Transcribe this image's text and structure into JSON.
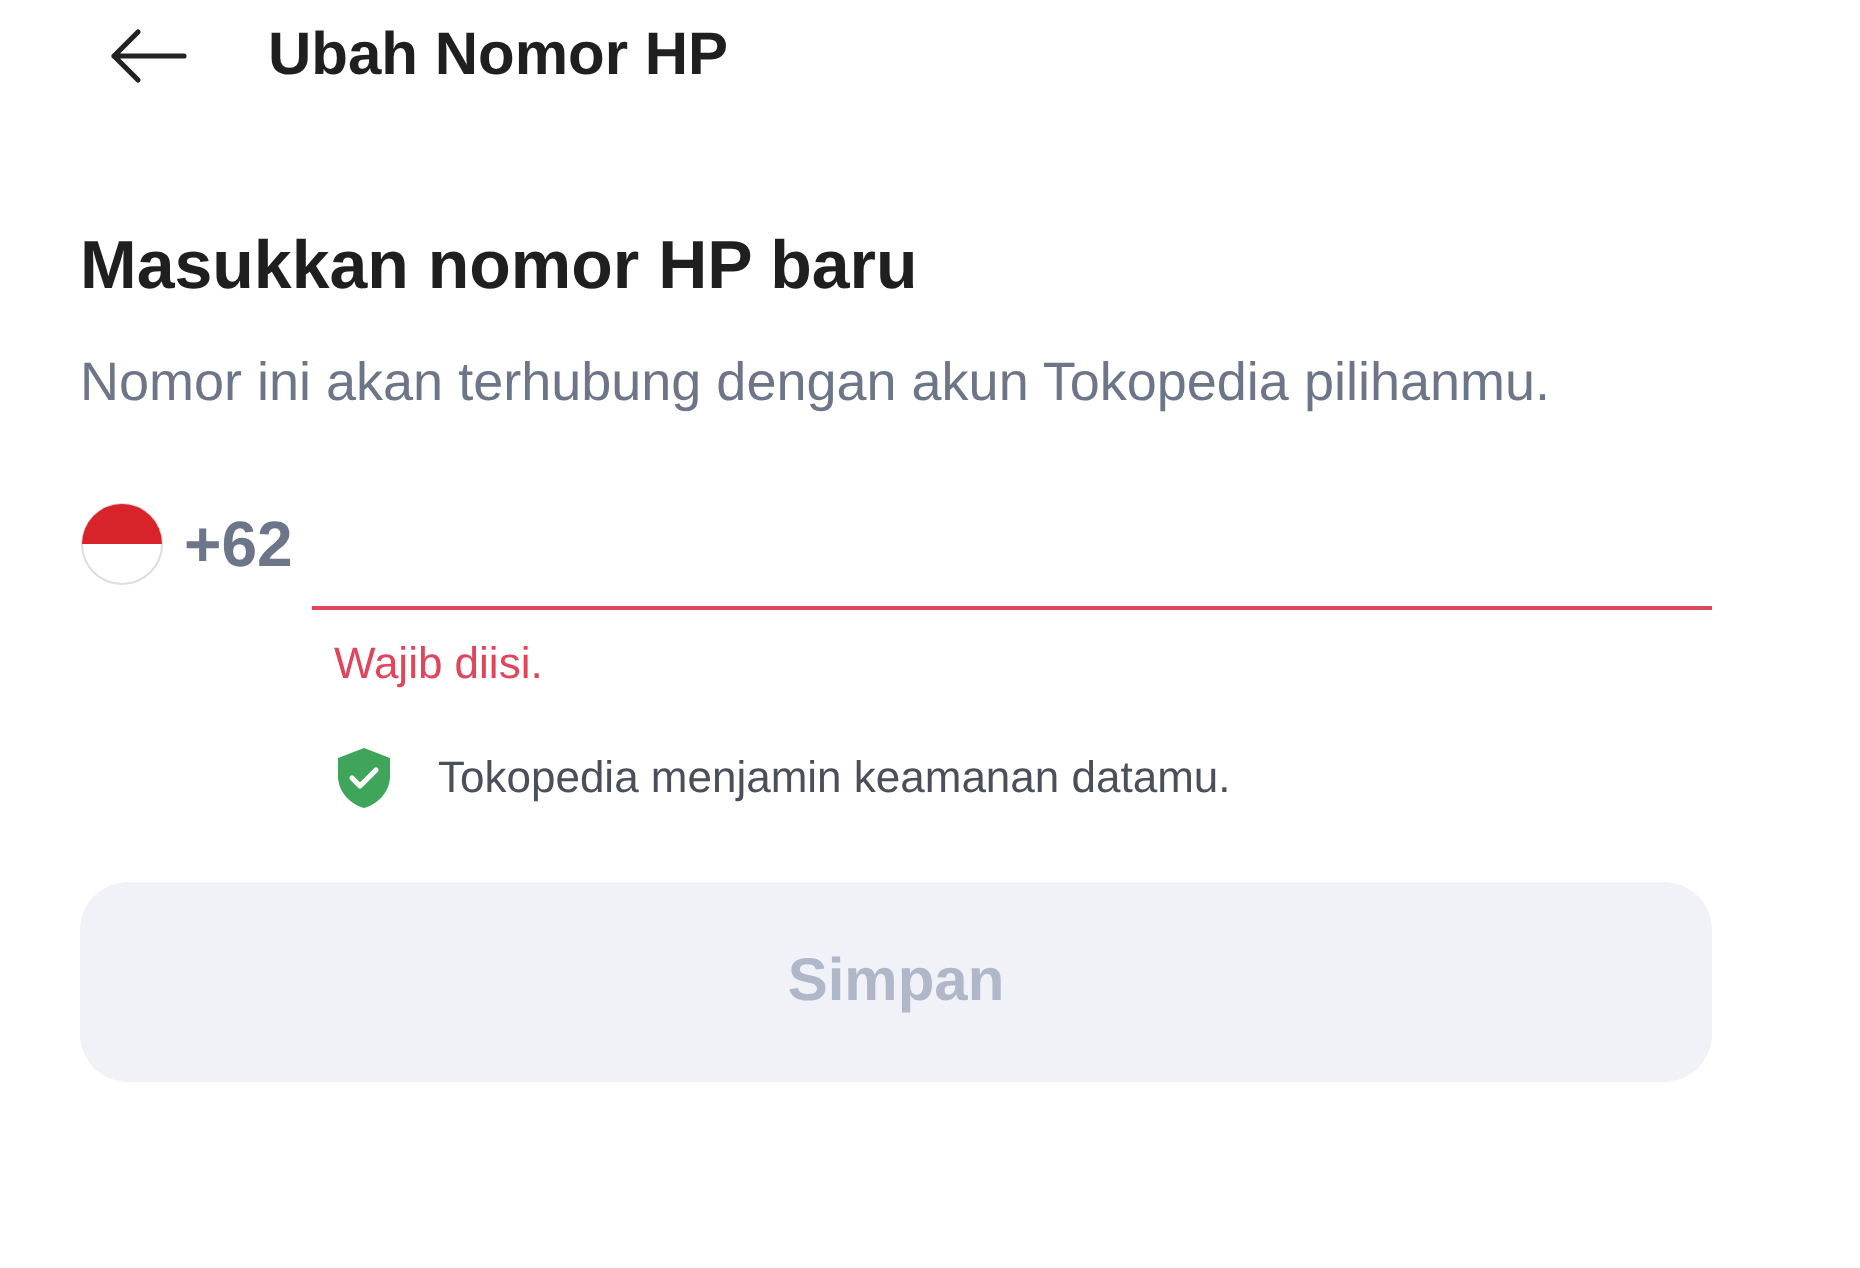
{
  "header": {
    "title": "Ubah Nomor HP"
  },
  "heading": "Masukkan nomor HP baru",
  "description": "Nomor ini akan terhubung dengan akun Tokopedia pilihanmu.",
  "phone": {
    "country_code": "+62",
    "invalid": true,
    "error": "Wajib diisi."
  },
  "security_note": "Tokopedia menjamin keamanan datamu.",
  "save_button": {
    "label": "Simpan",
    "disabled": true
  }
}
